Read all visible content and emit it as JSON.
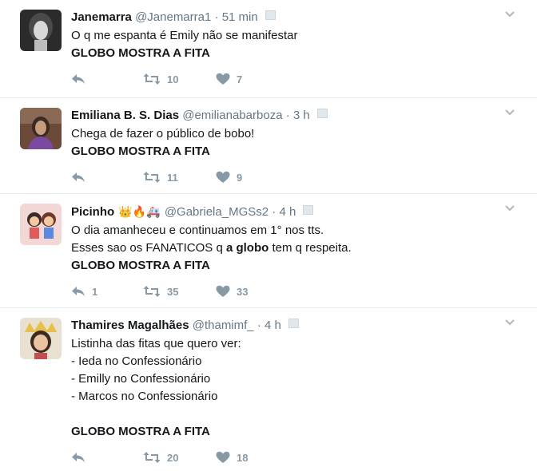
{
  "tweets": [
    {
      "fullname": "Janemarra",
      "badges": "",
      "username": "@Janemarra1",
      "sep": "·",
      "time": "51 min",
      "lines": [
        "O q me  espanta é Emily não se manifestar",
        "GLOBO MOSTRA A FITA"
      ],
      "replies": "",
      "retweets": "10",
      "likes": "7"
    },
    {
      "fullname": "Emiliana B. S. Dias",
      "badges": "",
      "username": "@emilianabarboza",
      "sep": "·",
      "time": "3 h",
      "lines": [
        "Chega de fazer o público de bobo!",
        "GLOBO MOSTRA A FITA"
      ],
      "replies": "",
      "retweets": "11",
      "likes": "9"
    },
    {
      "fullname": "Picinho",
      "badges": "👑🔥🚑",
      "username": "@Gabriela_MGSs2",
      "sep": "·",
      "time": "4 h",
      "lines": [
        "O dia amanheceu e continuamos em 1° nos tts.",
        "Esses sao os FANATICOS q ",
        "a globo",
        " tem q respeita.",
        "GLOBO MOSTRA A FITA"
      ],
      "replies": "1",
      "retweets": "35",
      "likes": "33"
    },
    {
      "fullname": "Thamires Magalhães",
      "badges": "",
      "username": "@thamimf_",
      "sep": "·",
      "time": "4 h",
      "lines": [
        "Listinha das fitas que quero ver:",
        "- Ieda no Confessionário",
        "- Emilly no Confessionário",
        "- Marcos no Confessionário",
        "GLOBO MOSTRA A FITA"
      ],
      "replies": "",
      "retweets": "20",
      "likes": "18"
    }
  ],
  "colors": {
    "name": "#14171a",
    "meta": "#657786",
    "action": "#8899a6",
    "divider": "#e6ecf0"
  },
  "icons": {
    "reply": "reply-icon",
    "retweet": "retweet-icon",
    "like": "heart-icon",
    "caret": "chevron-down-icon",
    "screen": "screen-icon"
  }
}
